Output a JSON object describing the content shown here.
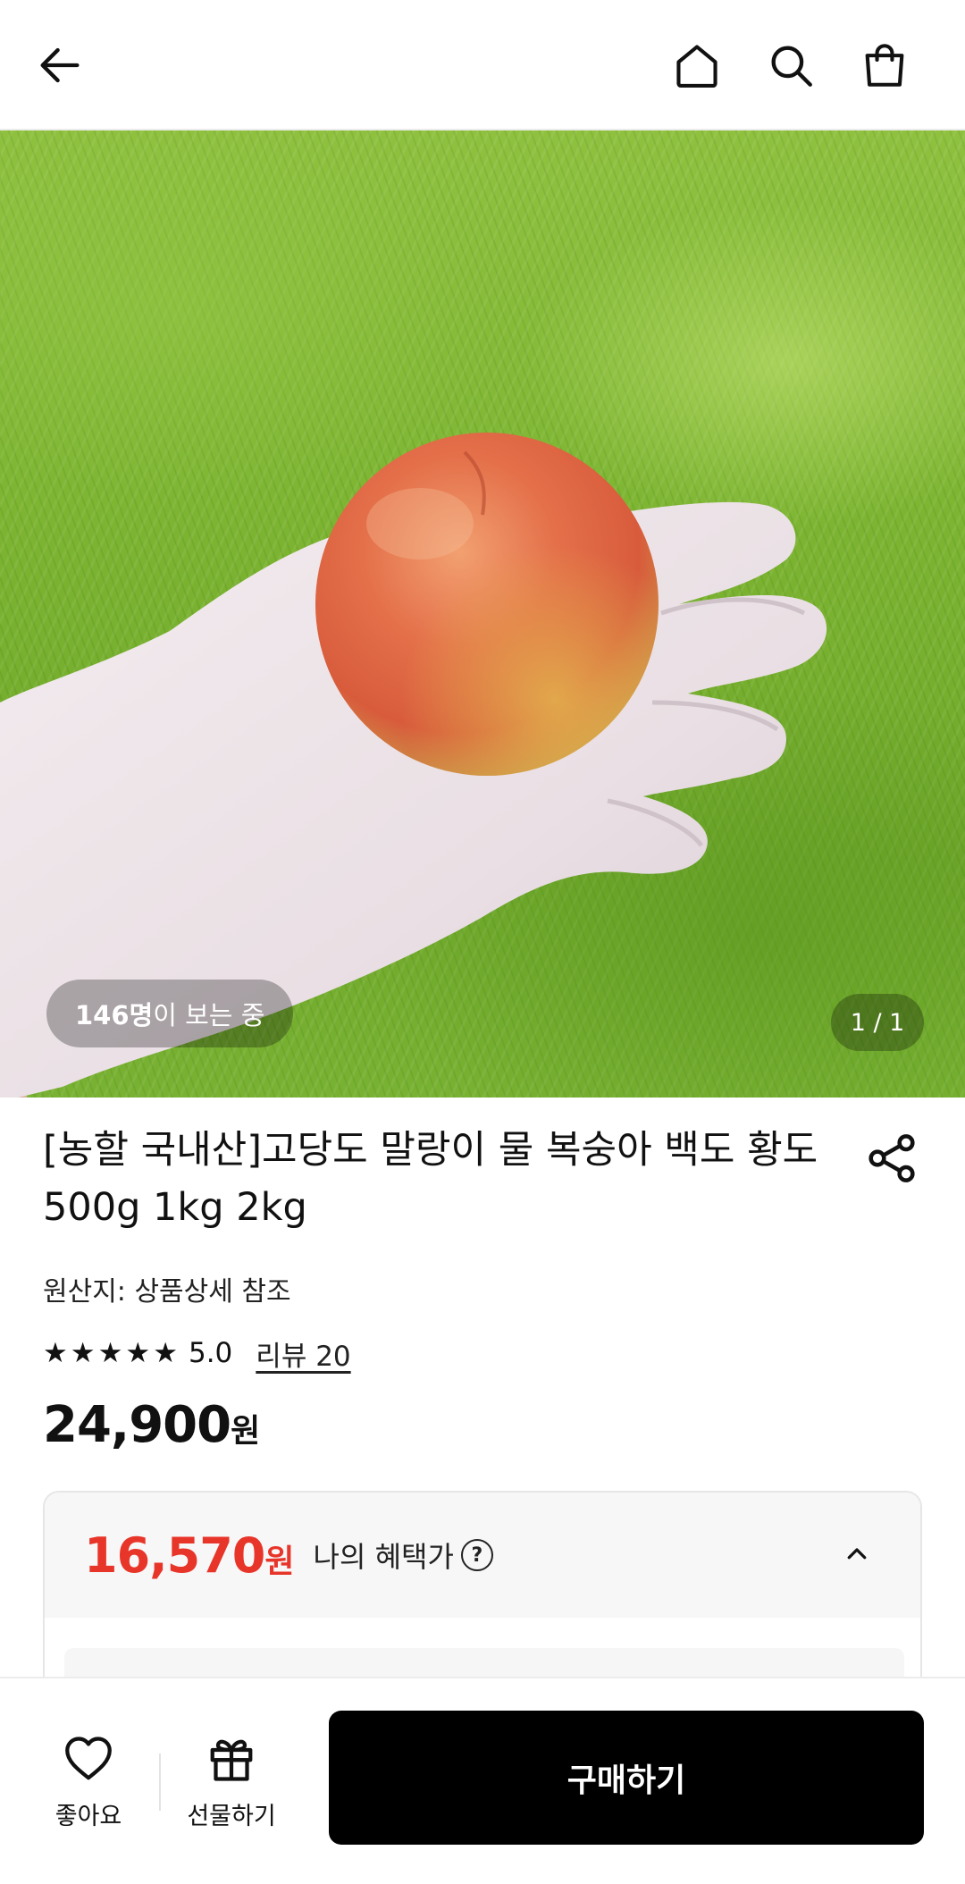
{
  "header": {
    "back_icon": "arrow-left-icon",
    "home_icon": "home-icon",
    "search_icon": "search-icon",
    "cart_icon": "shopping-bag-icon"
  },
  "hero": {
    "viewers_count": "146명",
    "viewers_suffix": "이 보는 중",
    "pager": "1 / 1"
  },
  "product": {
    "title": "[농할 국내산]고당도 말랑이 물 복숭아 백도 황도 500g 1kg 2kg",
    "origin": "원산지: 상품상세 참조",
    "rating_stars": 5,
    "rating_value": "5.0",
    "review_link": "리뷰 20",
    "price_number": "24,900",
    "price_unit": "원"
  },
  "benefit": {
    "sale_number": "16,570",
    "sale_unit": "원",
    "label": "나의 혜택가",
    "help": "?"
  },
  "bottom_bar": {
    "like_label": "좋아요",
    "gift_label": "선물하기",
    "buy_label": "구매하기"
  },
  "colors": {
    "accent_red": "#e8352a",
    "buy_button": "#000000"
  }
}
